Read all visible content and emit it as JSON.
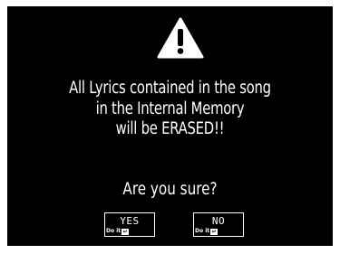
{
  "dialog": {
    "icon": "warning-icon",
    "message_lines": [
      "All Lyrics contained in the song",
      "in the Internal Memory",
      "will be ERASED!!"
    ],
    "question": "Are you sure?"
  },
  "buttons": {
    "yes": {
      "label": "YES",
      "hint": "Do it",
      "hint_icon": "enter-icon",
      "hint_glyph": "↵"
    },
    "no": {
      "label": "NO",
      "hint": "Do it",
      "hint_icon": "enter-icon",
      "hint_glyph": "↵"
    }
  },
  "colors": {
    "background": "#000000",
    "foreground": "#ffffff"
  }
}
